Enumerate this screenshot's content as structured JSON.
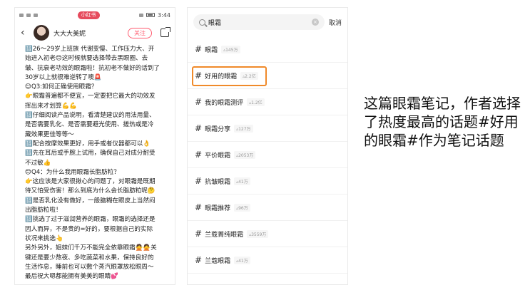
{
  "left_phone": {
    "status": {
      "badge": "小红书",
      "time": "3:44"
    },
    "header": {
      "back": "‹",
      "author": "大大大美妮",
      "follow": "关注"
    },
    "lines": [
      "🔢26～29岁上班族 代谢变慢、工作压力大、开",
      "始进入初老😊这时候就要选择带去黑眼圈、去",
      "皱、抗衰老功效的眼霜啦！抗初老不做好的话到了",
      "30岁以上就很难逆转了噢🚨",
      "😊Q3:如何正确使用眼霜？",
      "👉眼霜普遍都不便宜，一定要把它最大的功效发",
      "挥出来才划算💪💪",
      "🔢仔细阅读产品说明，看清楚建议的用法用量、",
      "是否需要乳化、是否需要避光使用、搓热或是冷",
      "藏效果更佳等等～",
      "🔢配合按摩效果更好，用手或者仪器都可以👌",
      "🔢先在耳后或手腕上试用，确保自己对成分耐受",
      "不过敏👍",
      "😊Q4：为什么我用眼霜长脂肪粒？",
      "👉这应该是大家很揪心的问题了，对眼霜是既期",
      "待又怕受伤害！那么到底为什么会长脂肪粒呢🤔",
      "🔢是否乳化没有做好，一般脑糊在眼皮上当然闷",
      "出脂肪粒啦！",
      "🔢挑选了过于滋润营养的眼霜，眼霜的选择还是",
      "因人而异，不是贵的=好的，要根据自己的实际",
      "状况来挑选👆",
      "另外另外，姐妹们千万不能完全依靠眼霜🙅🙅关",
      "键还是要少熬夜、多吃蔬菜和水果，保持良好的",
      "生活作息，睡前也可以敷个蒸汽眼罩放松眼周～",
      "最后祝大嗯都能拥有美美的眼睛💕"
    ]
  },
  "right_phone": {
    "search": {
      "query": "眼霜",
      "cancel": "取消"
    },
    "topics": [
      {
        "name": "眼霜",
        "count": "145万"
      },
      {
        "name": "好用的眼霜",
        "count": "2.2亿"
      },
      {
        "name": "我的眼霜测评",
        "count": "1.2亿"
      },
      {
        "name": "眼霜分享",
        "count": "127万"
      },
      {
        "name": "平价眼霜",
        "count": "2053万"
      },
      {
        "name": "抗皱眼霜",
        "count": "41万"
      },
      {
        "name": "眼霜推荐",
        "count": "96万"
      },
      {
        "name": "兰蔻菁纯眼霜",
        "count": "3559万"
      },
      {
        "name": "兰蔻眼霜",
        "count": "41万"
      }
    ],
    "hash": "#"
  },
  "caption": "这篇眼霜笔记，作者选择了热度最高的话题#好用的眼霜#作为笔记话题",
  "colors": {
    "highlight": "#f08a2a",
    "follow": "#ff5a6e",
    "badge": "#e64b5d"
  }
}
